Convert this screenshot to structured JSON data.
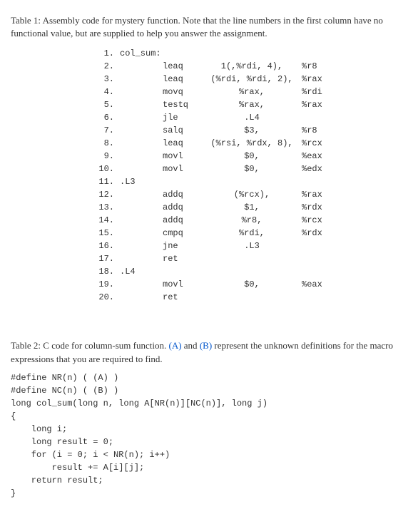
{
  "table1": {
    "caption": "Table 1: Assembly code for mystery function. Note that the line numbers in the first column have no functional value, but are supplied to help you answer the assignment.",
    "rows": [
      {
        "ln": "1.",
        "lbl": "col_sum:",
        "op": "",
        "arg1": "",
        "arg2": ""
      },
      {
        "ln": "2.",
        "lbl": "",
        "op": "leaq",
        "arg1": "1(,%rdi, 4),",
        "arg2": "%r8"
      },
      {
        "ln": "3.",
        "lbl": "",
        "op": "leaq",
        "arg1": "(%rdi, %rdi, 2),",
        "arg2": "%rax"
      },
      {
        "ln": "4.",
        "lbl": "",
        "op": "movq",
        "arg1": "%rax,",
        "arg2": "%rdi"
      },
      {
        "ln": "5.",
        "lbl": "",
        "op": "testq",
        "arg1": "%rax,",
        "arg2": "%rax"
      },
      {
        "ln": "6.",
        "lbl": "",
        "op": "jle",
        "arg1": ".L4",
        "arg2": ""
      },
      {
        "ln": "7.",
        "lbl": "",
        "op": "salq",
        "arg1": "$3,",
        "arg2": "%r8"
      },
      {
        "ln": "8.",
        "lbl": "",
        "op": "leaq",
        "arg1": "(%rsi, %rdx, 8),",
        "arg2": "%rcx"
      },
      {
        "ln": "9.",
        "lbl": "",
        "op": "movl",
        "arg1": "$0,",
        "arg2": "%eax"
      },
      {
        "ln": "10.",
        "lbl": "",
        "op": "movl",
        "arg1": "$0,",
        "arg2": "%edx"
      },
      {
        "ln": "11.",
        "lbl": ".L3",
        "op": "",
        "arg1": "",
        "arg2": ""
      },
      {
        "ln": "12.",
        "lbl": "",
        "op": "addq",
        "arg1": "(%rcx),",
        "arg2": "%rax"
      },
      {
        "ln": "13.",
        "lbl": "",
        "op": "addq",
        "arg1": "$1,",
        "arg2": "%rdx"
      },
      {
        "ln": "14.",
        "lbl": "",
        "op": "addq",
        "arg1": "%r8,",
        "arg2": "%rcx"
      },
      {
        "ln": "15.",
        "lbl": "",
        "op": "cmpq",
        "arg1": "%rdi,",
        "arg2": "%rdx"
      },
      {
        "ln": "16.",
        "lbl": "",
        "op": "jne",
        "arg1": ".L3",
        "arg2": ""
      },
      {
        "ln": "17.",
        "lbl": "",
        "op": "ret",
        "arg1": "",
        "arg2": ""
      },
      {
        "ln": "18.",
        "lbl": ".L4",
        "op": "",
        "arg1": "",
        "arg2": ""
      },
      {
        "ln": "19.",
        "lbl": "",
        "op": "movl",
        "arg1": "$0,",
        "arg2": "%eax"
      },
      {
        "ln": "20.",
        "lbl": "",
        "op": "ret",
        "arg1": "",
        "arg2": ""
      }
    ]
  },
  "table2": {
    "caption_pre": "Table 2: C code for column-sum function. ",
    "A": "(A)",
    "mid": " and ",
    "B": "(B)",
    "caption_post": " represent the unknown definitions for the macro expressions that you are required to find.",
    "code": "#define NR(n) ( (A) )\n#define NC(n) ( (B) )\nlong col_sum(long n, long A[NR(n)][NC(n)], long j)\n{\n    long i;\n    long result = 0;\n    for (i = 0; i < NR(n); i++)\n        result += A[i][j];\n    return result;\n}"
  }
}
